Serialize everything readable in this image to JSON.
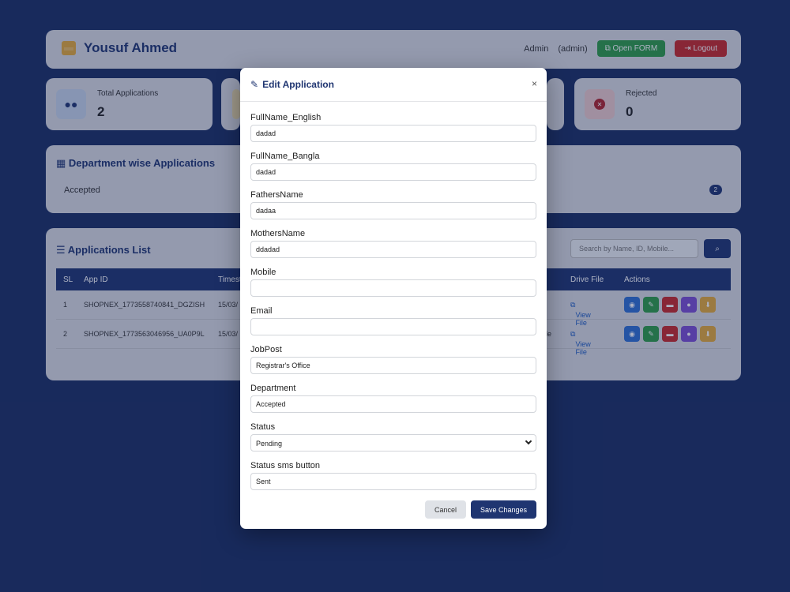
{
  "header": {
    "brand": "Yousuf Ahmed",
    "user_role": "Admin",
    "user_name": "(admin)",
    "open_form_label": "Open FORM",
    "logout_label": "Logout"
  },
  "stats": [
    {
      "label": "Total Applications",
      "value": "2"
    },
    {
      "label": "Rejected",
      "value": "0"
    }
  ],
  "department": {
    "title": "Department wise Applications",
    "rows": [
      {
        "name": "Accepted",
        "count": "2"
      }
    ]
  },
  "applications": {
    "title": "Applications List",
    "search_placeholder": "Search by Name, ID, Mobile...",
    "columns": [
      "SL",
      "App ID",
      "Timest",
      "Drive File",
      "Actions"
    ],
    "rows": [
      {
        "sl": "1",
        "app_id": "SHOPNEX_1773558740841_DGZISH",
        "timestamp": "15/03/",
        "drive": "View File",
        "extra": ""
      },
      {
        "sl": "2",
        "app_id": "SHOPNEX_1773563046956_UA0P9L",
        "timestamp": "15/03/",
        "drive": "View File",
        "extra": "le"
      }
    ]
  },
  "modal": {
    "title": "Edit Application",
    "close": "×",
    "fields": [
      {
        "label": "FullName_English",
        "value": "dadad"
      },
      {
        "label": "FullName_Bangla",
        "value": "dadad"
      },
      {
        "label": "FathersName",
        "value": "dadaa"
      },
      {
        "label": "MothersName",
        "value": "ddadad"
      },
      {
        "label": "Mobile",
        "value": ""
      },
      {
        "label": "Email",
        "value": ""
      },
      {
        "label": "JobPost",
        "value": "Registrar's Office"
      },
      {
        "label": "Department",
        "value": "Accepted"
      },
      {
        "label": "Status",
        "value": "Pending"
      },
      {
        "label": "Status sms button",
        "value": "Sent"
      }
    ],
    "cancel_label": "Cancel",
    "save_label": "Save Changes"
  },
  "colors": {
    "background": "#1b2e63",
    "primary": "#1f3571",
    "success": "#2f9b48",
    "danger": "#c62828",
    "warning": "#e4a93a"
  },
  "icons": {
    "brand": "store-icon",
    "open_form": "external-link-icon",
    "logout": "logout-icon",
    "total": "users-icon",
    "rejected": "x-circle-icon",
    "department": "building-icon",
    "list": "list-icon",
    "search": "search-icon",
    "edit": "edit-icon",
    "close": "close-icon"
  }
}
